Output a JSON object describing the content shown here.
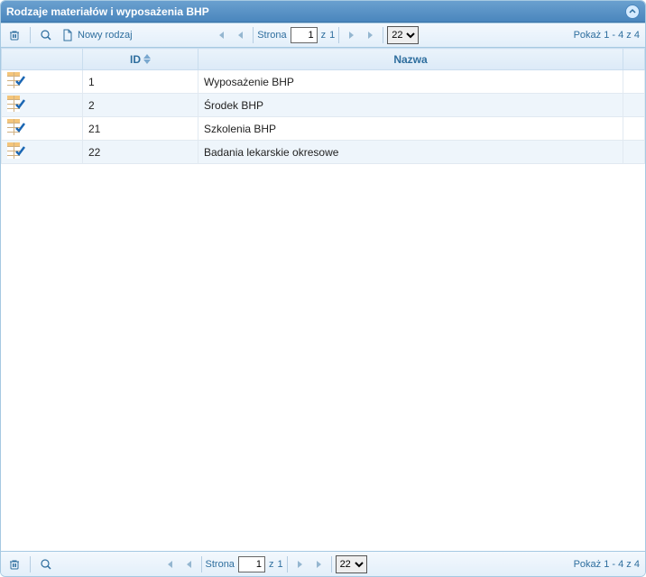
{
  "panel": {
    "title": "Rodzaje materiałów i wyposażenia BHP"
  },
  "toolbar": {
    "new_record_label": "Nowy rodzaj",
    "page_prefix": "Strona",
    "page_value": "1",
    "page_total_prefix": "z",
    "page_total": "1",
    "rowcount_value": "22",
    "showing_text": "Pokaż 1 - 4 z 4"
  },
  "columns": {
    "id": "ID",
    "name": "Nazwa"
  },
  "rows": [
    {
      "id": "1",
      "name": "Wyposażenie BHP"
    },
    {
      "id": "2",
      "name": "Środek BHP"
    },
    {
      "id": "21",
      "name": "Szkolenia BHP"
    },
    {
      "id": "22",
      "name": "Badania lekarskie okresowe"
    }
  ]
}
